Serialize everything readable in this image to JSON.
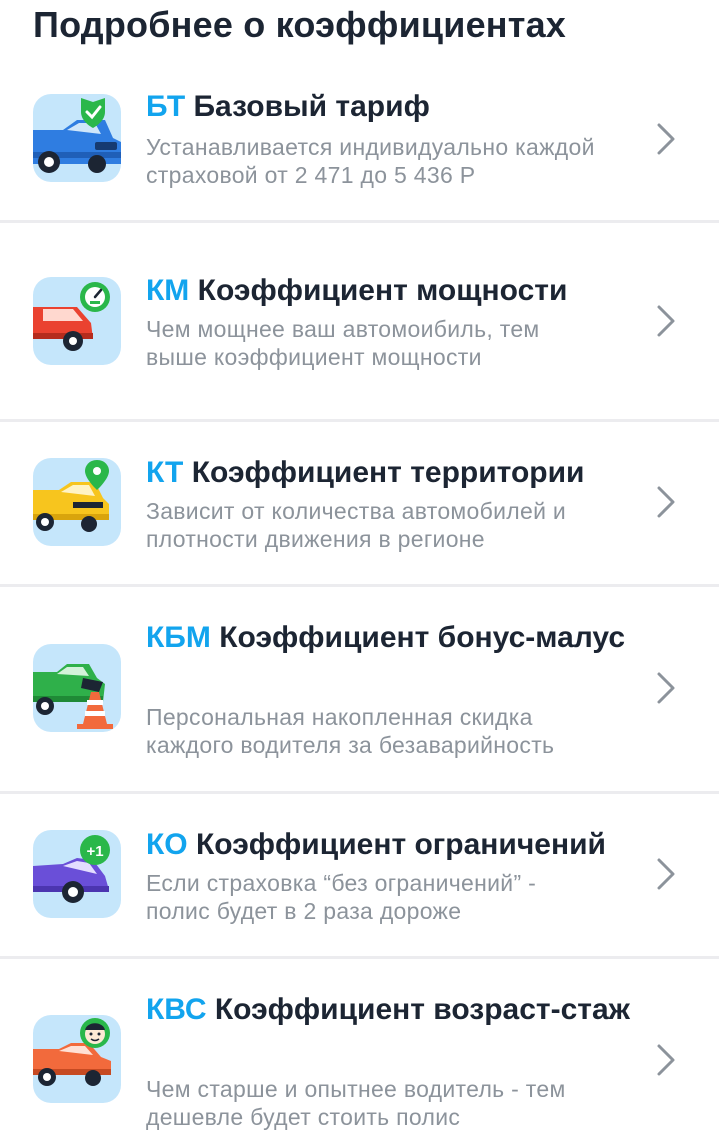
{
  "page": {
    "title": "Подробнее о коэффициентах"
  },
  "items": [
    {
      "abbr": "БТ",
      "title": "Базовый тариф",
      "description": "Устанавливается индивидуально каждой страховой от 2 471 до 5 436 Р",
      "icon": "car-shield-icon",
      "car_color": "#2f7de1",
      "badge_color": "#2ab74a"
    },
    {
      "abbr": "КМ",
      "title": "Коэффициент мощности",
      "description": "Чем мощнее ваш автомоибиль, тем выше коэффициент мощности",
      "icon": "car-speedometer-icon",
      "car_color": "#ea4230",
      "badge_color": "#2ab74a"
    },
    {
      "abbr": "КТ",
      "title": "Коэффициент территории",
      "description": "Зависит от количества автомобилей и плотности движения в регионе",
      "icon": "car-location-pin-icon",
      "car_color": "#f7c51e",
      "badge_color": "#2ab74a"
    },
    {
      "abbr": "КБМ",
      "title": "Коэффициент бонус-малус",
      "description": "Персональная накопленная скидка каждого водителя за безаварийность",
      "icon": "car-traffic-cone-icon",
      "car_color": "#2fb04a",
      "badge_color": "#f26a3c"
    },
    {
      "abbr": "КО",
      "title": "Коэффициент ограничений",
      "description": "Если страховка “без ограничений” - полис будет в 2 раза дороже",
      "icon": "car-plus-one-icon",
      "car_color": "#6a4fd8",
      "badge_color": "#2ab74a",
      "badge_text": "+1"
    },
    {
      "abbr": "КВС",
      "title": "Коэффициент возраст-стаж",
      "description": "Чем старше и опытнее водитель - тем дешевле будет стоить полис",
      "icon": "car-driver-avatar-icon",
      "car_color": "#f26a3c",
      "badge_color": "#2ab74a"
    }
  ]
}
